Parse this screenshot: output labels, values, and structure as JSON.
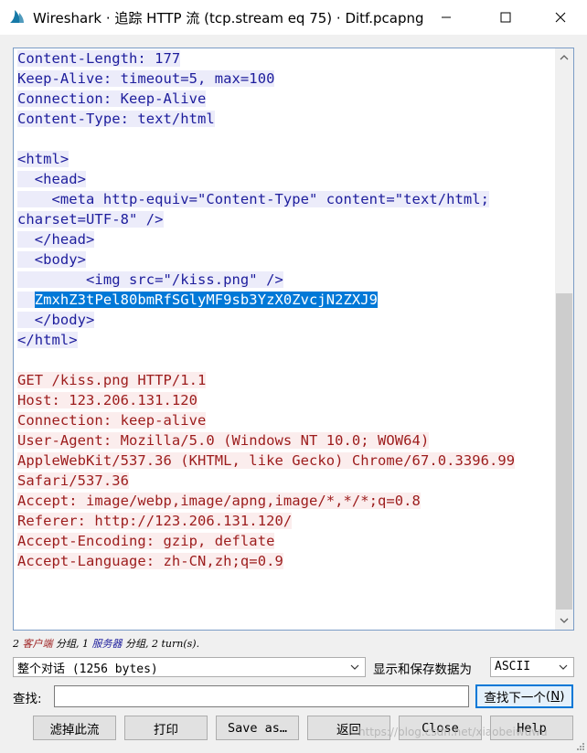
{
  "window": {
    "title": "Wireshark · 追踪 HTTP 流 (tcp.stream eq 75) · Ditf.pcapng"
  },
  "stream_lines": [
    {
      "text": "Content-Length: 177",
      "side": "server"
    },
    {
      "text": "Keep-Alive: timeout=5, max=100",
      "side": "server"
    },
    {
      "text": "Connection: Keep-Alive",
      "side": "server"
    },
    {
      "text": "Content-Type: text/html",
      "side": "server"
    },
    {
      "text": "",
      "side": "blank"
    },
    {
      "text": "<html>",
      "side": "server"
    },
    {
      "text": "  <head>",
      "side": "server"
    },
    {
      "text": "    <meta http-equiv=\"Content-Type\" content=\"text/html;",
      "side": "server"
    },
    {
      "text": "charset=UTF-8\" />",
      "side": "server"
    },
    {
      "text": "  </head>",
      "side": "server"
    },
    {
      "text": "  <body>",
      "side": "server"
    },
    {
      "text": "        <img src=\"/kiss.png\" />",
      "side": "server"
    },
    {
      "text": "  ",
      "side": "server",
      "highlight": "ZmxhZ3tPel80bmRfSGlyMF9sb3YzX0ZvcjN2ZXJ9"
    },
    {
      "text": "  </body>",
      "side": "server"
    },
    {
      "text": "</html>",
      "side": "server"
    },
    {
      "text": "",
      "side": "blank"
    },
    {
      "text": "GET /kiss.png HTTP/1.1",
      "side": "client"
    },
    {
      "text": "Host: 123.206.131.120",
      "side": "client"
    },
    {
      "text": "Connection: keep-alive",
      "side": "client"
    },
    {
      "text": "User-Agent: Mozilla/5.0 (Windows NT 10.0; WOW64)",
      "side": "client"
    },
    {
      "text": "AppleWebKit/537.36 (KHTML, like Gecko) Chrome/67.0.3396.99",
      "side": "client"
    },
    {
      "text": "Safari/537.36",
      "side": "client"
    },
    {
      "text": "Accept: image/webp,image/apng,image/*,*/*;q=0.8",
      "side": "client"
    },
    {
      "text": "Referer: http://123.206.131.120/",
      "side": "client"
    },
    {
      "text": "Accept-Encoding: gzip, deflate",
      "side": "client"
    },
    {
      "text": "Accept-Language: zh-CN,zh;q=0.9",
      "side": "client"
    }
  ],
  "status": {
    "client_count": "2",
    "client_label": "客户端",
    "mid1": "分组, 1",
    "server_label": "服务器",
    "mid2": "分组, 2 turn(s)."
  },
  "conversation_select": {
    "value": "整个对话 (1256 bytes)"
  },
  "format": {
    "label": "显示和保存数据为",
    "value": "ASCII"
  },
  "find": {
    "label": "查找:",
    "value": "",
    "next_label": "查找下一个",
    "next_key": "N"
  },
  "buttons": {
    "filter_out": "滤掉此流",
    "print": "打印",
    "save_as": "Save as…",
    "back": "返回",
    "close": "Close",
    "help": "Help"
  },
  "watermark": "https://blog.csdn.net/xiaobeiwuwu",
  "colors": {
    "server_bg": "#ececfa",
    "server_fg": "#1d1d9c",
    "client_bg": "#fbeded",
    "client_fg": "#9c1c1c",
    "selection": "#0078d7"
  }
}
